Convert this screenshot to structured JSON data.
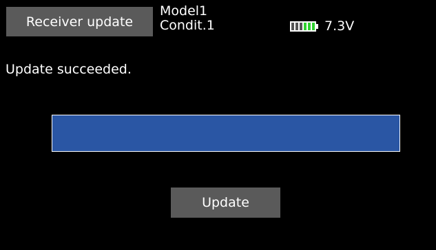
{
  "header": {
    "title": "Receiver update",
    "model_name": "Model1",
    "condition": "Condit.1",
    "battery": {
      "icon": "battery-icon",
      "cell_colors": [
        "#555555",
        "#555555",
        "#555555",
        "#2fd12f",
        "#2fd12f",
        "#2fd12f"
      ],
      "voltage": "7.3V"
    }
  },
  "main": {
    "status_message": "Update succeeded.",
    "progress": {
      "fraction": 1.0,
      "fill_color": "#2a56a4"
    },
    "update_button_label": "Update"
  }
}
